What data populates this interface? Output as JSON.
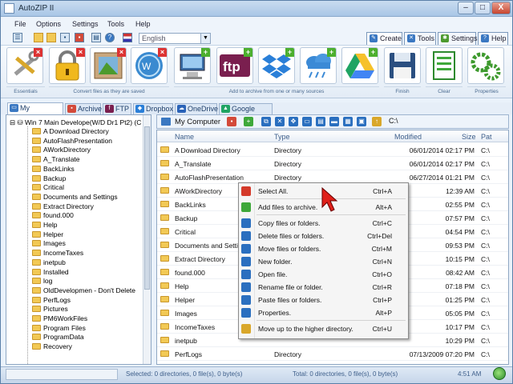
{
  "window": {
    "title": "AutoZIP II",
    "min_label": "–",
    "max_label": "□",
    "close_label": "X"
  },
  "menu": [
    "File",
    "Options",
    "Settings",
    "Tools",
    "Help"
  ],
  "toolbar": {
    "language": "English"
  },
  "top_tabs": [
    {
      "label": "Create",
      "icon": "create-icon"
    },
    {
      "label": "Tools",
      "icon": "tools-icon"
    },
    {
      "label": "Settings",
      "icon": "gear-icon"
    },
    {
      "label": "Help",
      "icon": "help-icon"
    }
  ],
  "ribbon": {
    "buttons": [
      {
        "name": "essentials",
        "icon": "wrench-screwdriver-icon",
        "badge": "x"
      },
      {
        "name": "lock",
        "icon": "padlock-icon",
        "badge": "x"
      },
      {
        "name": "image-chart",
        "icon": "image-icon",
        "badge": "x"
      },
      {
        "name": "windows",
        "icon": "windows-logo-icon",
        "badge": "x"
      },
      {
        "name": "computer",
        "icon": "computer-icon",
        "badge": "+"
      },
      {
        "name": "ftp",
        "icon": "ftp-icon",
        "badge": "+",
        "text": "ftp"
      },
      {
        "name": "dropbox",
        "icon": "dropbox-icon",
        "badge": "+"
      },
      {
        "name": "cloud",
        "icon": "cloud-icon",
        "badge": "+"
      },
      {
        "name": "google-drive",
        "icon": "google-drive-icon",
        "badge": "+"
      },
      {
        "name": "finish",
        "icon": "floppy-disk-icon",
        "badge": ""
      },
      {
        "name": "clear",
        "icon": "clear-document-icon",
        "badge": ""
      },
      {
        "name": "properties",
        "icon": "gears-icon",
        "badge": ""
      }
    ],
    "group_labels": [
      "Essentials",
      "Convert files as they are saved",
      "Add to archive from one or many sources",
      "Finish",
      "Clear",
      "Properties"
    ]
  },
  "nav_tabs": [
    "My Computer",
    "Archive",
    "FTP",
    "Dropbox",
    "OneDrive",
    "Google Drive"
  ],
  "tree": {
    "root": "Win 7 Main Develope(W/D Dr1 Pt2) (C",
    "items": [
      "A Download Directory",
      "AutoFlashPresentation",
      "AWorkDirectory",
      "A_Translate",
      "BackLinks",
      "Backup",
      "Critical",
      "Documents and Settings",
      "Extract Directory",
      "found.000",
      "Help",
      "Helper",
      "Images",
      "IncomeTaxes",
      "inetpub",
      "Installed",
      "log",
      "OldDevelopmen - Don't Delete",
      "PerfLogs",
      "Pictures",
      "PM6WorkFiles",
      "Program Files",
      "ProgramData",
      "Recovery"
    ]
  },
  "pathbar": {
    "location": "My Computer",
    "path": "C:\\"
  },
  "list": {
    "columns": [
      "Name",
      "Type",
      "Modified",
      "Size",
      "Pat"
    ],
    "rows": [
      {
        "name": "A Download Directory",
        "type": "Directory",
        "modified": "06/01/2014 02:17 PM",
        "size": "",
        "path": "C:\\"
      },
      {
        "name": "A_Translate",
        "type": "Directory",
        "modified": "06/01/2014 02:17 PM",
        "size": "",
        "path": "C:\\"
      },
      {
        "name": "AutoFlashPresentation",
        "type": "Directory",
        "modified": "06/27/2014 01:21 PM",
        "size": "",
        "path": "C:\\"
      },
      {
        "name": "AWorkDirectory",
        "type": "",
        "modified": "12:39 AM",
        "size": "",
        "path": "C:\\"
      },
      {
        "name": "BackLinks",
        "type": "",
        "modified": "02:55 PM",
        "size": "",
        "path": "C:\\"
      },
      {
        "name": "Backup",
        "type": "",
        "modified": "07:57 PM",
        "size": "",
        "path": "C:\\"
      },
      {
        "name": "Critical",
        "type": "",
        "modified": "04:54 PM",
        "size": "",
        "path": "C:\\"
      },
      {
        "name": "Documents and Settings",
        "type": "",
        "modified": "09:53 PM",
        "size": "",
        "path": "C:\\"
      },
      {
        "name": "Extract Directory",
        "type": "",
        "modified": "10:15 PM",
        "size": "",
        "path": "C:\\"
      },
      {
        "name": "found.000",
        "type": "",
        "modified": "08:42 AM",
        "size": "",
        "path": "C:\\"
      },
      {
        "name": "Help",
        "type": "",
        "modified": "07:18 PM",
        "size": "",
        "path": "C:\\"
      },
      {
        "name": "Helper",
        "type": "",
        "modified": "01:25 PM",
        "size": "",
        "path": "C:\\"
      },
      {
        "name": "Images",
        "type": "",
        "modified": "05:05 PM",
        "size": "",
        "path": "C:\\"
      },
      {
        "name": "IncomeTaxes",
        "type": "",
        "modified": "10:17 PM",
        "size": "",
        "path": "C:\\"
      },
      {
        "name": "inetpub",
        "type": "",
        "modified": "10:29 PM",
        "size": "",
        "path": "C:\\"
      },
      {
        "name": "PerfLogs",
        "type": "Directory",
        "modified": "07/13/2009 07:20 PM",
        "size": "",
        "path": "C:\\"
      }
    ]
  },
  "context_menu": [
    {
      "label": "Select All.",
      "shortcut": "Ctrl+A",
      "icon": "select-all-icon",
      "color": "#d43a2a"
    },
    {
      "label": "Add files to archive.",
      "shortcut": "Alt+A",
      "icon": "add-icon",
      "color": "#3ea83a",
      "sep_before": true
    },
    {
      "label": "Copy files or folders.",
      "shortcut": "Ctrl+C",
      "icon": "copy-icon",
      "color": "#2a6fbf",
      "sep_before": true
    },
    {
      "label": "Delete files or folders.",
      "shortcut": "Ctrl+Del",
      "icon": "delete-icon",
      "color": "#2a6fbf"
    },
    {
      "label": "Move files or folders.",
      "shortcut": "Ctrl+M",
      "icon": "move-icon",
      "color": "#2a6fbf"
    },
    {
      "label": "New folder.",
      "shortcut": "Ctrl+N",
      "icon": "new-folder-icon",
      "color": "#2a6fbf"
    },
    {
      "label": "Open file.",
      "shortcut": "Ctrl+O",
      "icon": "open-file-icon",
      "color": "#2a6fbf"
    },
    {
      "label": "Rename file or folder.",
      "shortcut": "Ctrl+R",
      "icon": "rename-icon",
      "color": "#2a6fbf"
    },
    {
      "label": "Paste files or folders.",
      "shortcut": "Ctrl+P",
      "icon": "paste-icon",
      "color": "#2a6fbf"
    },
    {
      "label": "Properties.",
      "shortcut": "Alt+P",
      "icon": "properties-icon",
      "color": "#2a6fbf"
    },
    {
      "label": "Move up to the higher directory.",
      "shortcut": "Ctrl+U",
      "icon": "up-directory-icon",
      "color": "#d9a72a",
      "sep_before": true
    }
  ],
  "status": {
    "selected": "Selected: 0 directories, 0 file(s), 0 byte(s)",
    "total": "Total: 0 directories, 0 file(s), 0 byte(s)",
    "time": "4:51 AM"
  },
  "colors": {
    "accent": "#3a78c2",
    "folder": "#f2c955",
    "window_bg": "#eaf2fb"
  }
}
